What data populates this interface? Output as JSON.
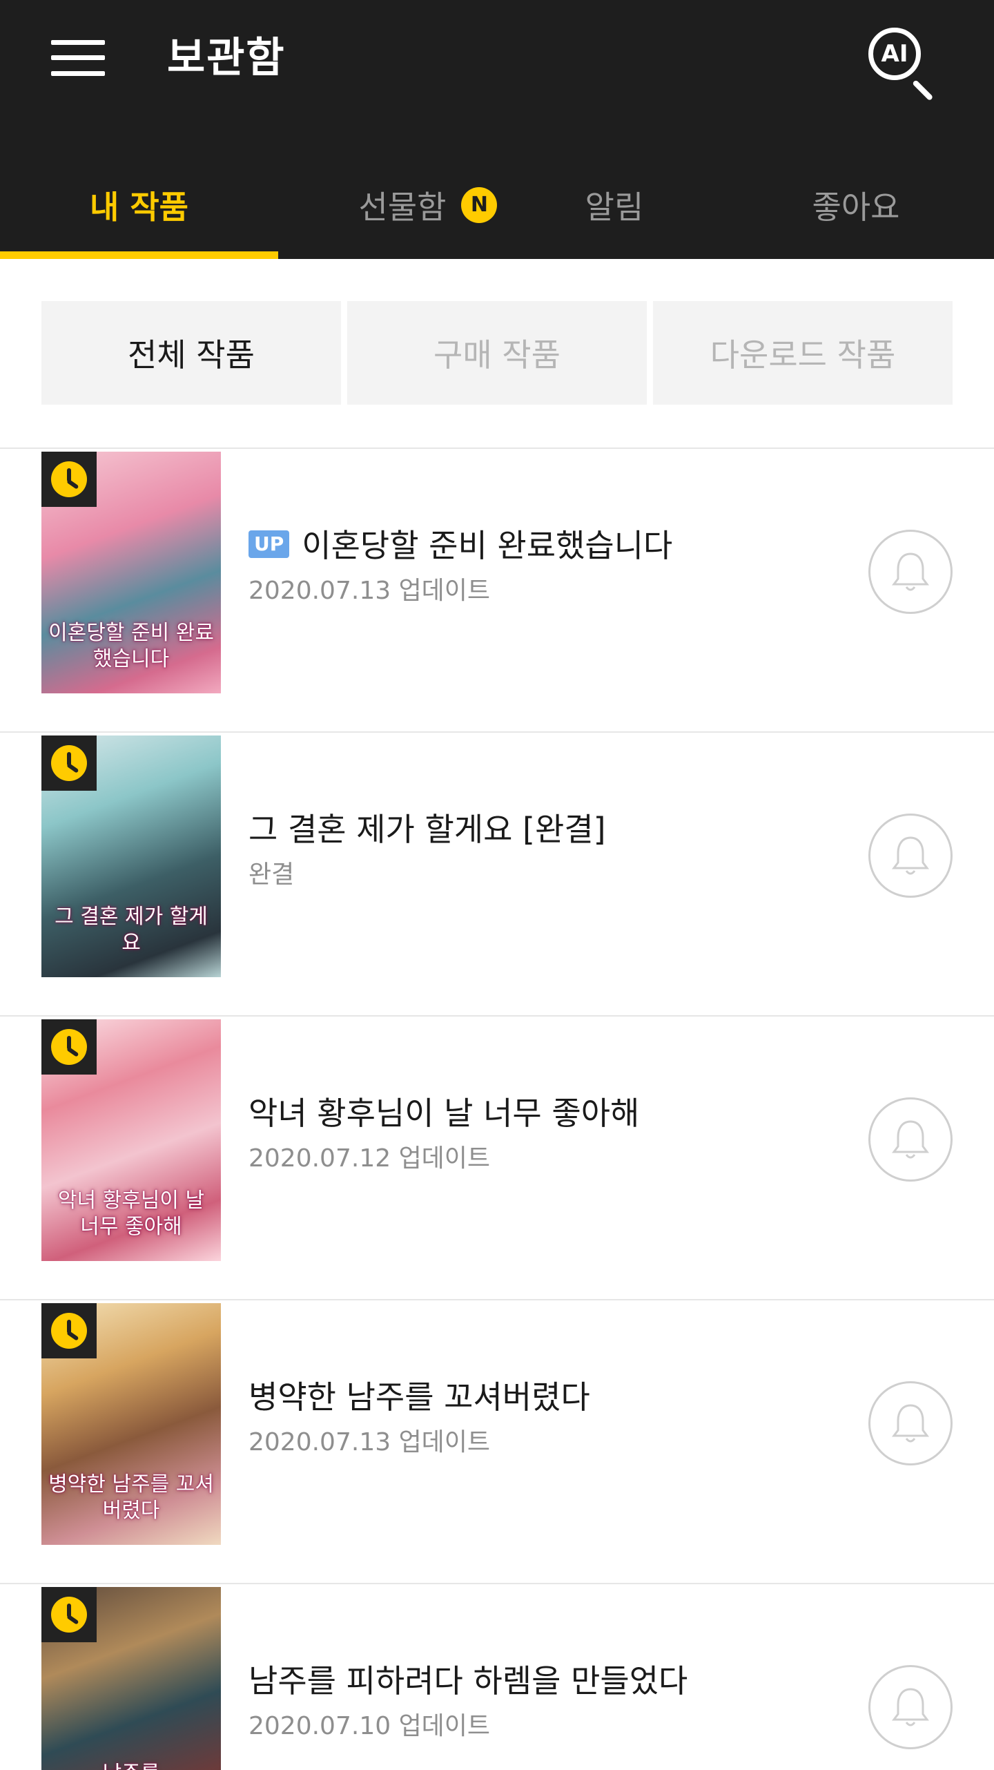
{
  "header": {
    "title": "보관함",
    "ai_label": "AI"
  },
  "tabs": [
    {
      "label": "내 작품",
      "active": true
    },
    {
      "label": "선물함",
      "badge": "N"
    },
    {
      "label": "알림"
    },
    {
      "label": "좋아요"
    }
  ],
  "filters": [
    {
      "label": "전체 작품",
      "active": true
    },
    {
      "label": "구매 작품"
    },
    {
      "label": "다운로드 작품"
    }
  ],
  "works": [
    {
      "title": "이혼당할 준비 완료했습니다",
      "up_badge": "UP",
      "subtitle": "2020.07.13 업데이트",
      "cover_title": "이혼당할 준비 완료했습니다"
    },
    {
      "title": "그 결혼 제가 할게요 [완결]",
      "subtitle": "완결",
      "cover_title": "그 결혼 제가 할게요"
    },
    {
      "title": "악녀 황후님이 날 너무 좋아해",
      "subtitle": "2020.07.12 업데이트",
      "cover_title": "악녀 황후님이 날 너무 좋아해"
    },
    {
      "title": "병약한 남주를 꼬셔버렸다",
      "subtitle": "2020.07.13 업데이트",
      "cover_title": "병약한 남주를 꼬셔버렸다"
    },
    {
      "title": "남주를 피하려다 하렘을 만들었다",
      "subtitle": "2020.07.10 업데이트",
      "cover_title": "남주를"
    }
  ],
  "colors": {
    "header_bg": "#1e1e1e",
    "accent": "#ffcb00",
    "up_badge": "#6aa6ea"
  }
}
